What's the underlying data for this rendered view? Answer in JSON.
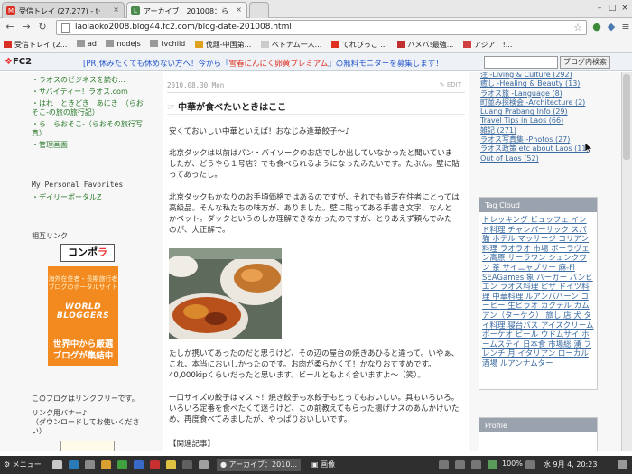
{
  "tabs": [
    {
      "label": "受信トレイ (27,277) - t·",
      "icon": "M",
      "color": "#d93025"
    },
    {
      "label": "アーカイブ：201008：ら",
      "icon": "L",
      "color": "#4a8a4a"
    }
  ],
  "url": "laolaoko2008.blog44.fc2.com/blog-date-201008.html",
  "bookmarks": [
    "受信トレイ (2...",
    "ad",
    "nodejs",
    "tvchild",
    "伐題-中国第...",
    "ベトナム一人...",
    "てれびっこ ...",
    "ハメバ!最強...",
    "アジア！!..."
  ],
  "fc2": {
    "logo": "FC2",
    "msg_a": "[PR]休みたくても休めない方へ！今から『",
    "msg_b": "雪春にんにく卵黄プレミアム",
    "msg_c": "』の無料モニターを募集します！",
    "search_button": "ブログ内検索"
  },
  "left": {
    "links_top": [
      "ラオスのビジネスを読む...",
      "サバイディー！ラオス.com",
      "はれ　ときどき　あにき　（らおそこ-の旅の旅行記）",
      "ら　らおそこ-（らおその旅行写真）",
      "管理画面"
    ],
    "favorites_title": "My Personal Favorites",
    "favorites": [
      "デイリーポータルZ"
    ],
    "mutual_title": "相互リンク",
    "comp_a": "コンポ",
    "comp_b": "ラ",
    "banner_a": "海外在住者・長期旅行者\nブログのポータルサイト",
    "banner_b": "WORLD BLOGGERS",
    "banner_c": "世界中から厳選\nブログが集結中",
    "linkfree": "このブログはリンクフリーです。",
    "banner_title": "リンク用バナー♪\n（ダウンロードしてお使いください）"
  },
  "post": {
    "date": "2010.08.30 Mon",
    "edit": "EDIT",
    "title": "中華が食べたいときはここ",
    "p1": "安くておいしい中華といえば！おなじみ逢華餃子〜♪",
    "p2": "北京ダックは以前はパン・バイソークのお店でしか出していなかったと聞いていましたが、どうやら１号店？でも食べられるようになったみたいです。たぶん。壁に貼ってあったし。",
    "p3": "北京ダックもかなりのお手頃価格ではあるのですが、それでも貧乏在住者にとっては高級品。そんな私たちの味方が、ありました。壁に貼ってある手書き文字、なんとかベット。ダックというのしか理解できなかったのですが、とりあえず頼んでみたのが、大正解で。",
    "p4": "たしか携いてあったのだと思うけど、その辺の屋台の焼きあひると違って。いやぁ、これ、本当においしかったのです。お肉が柔らかくて！かなりおすすめです。40,000kipくらいだったと思います。ビールともよく合いますよ〜（笑）。",
    "p5": "一口サイズの餃子はマスト！焼き餃子も水餃子もとってもおいしい。具もいろいろ。いろいろ定番を食べたくて迷うけど、この前教えてもらった揚げナスのあんかけいため、再度食べてみましたが、やっぱりおいしいです。",
    "related": "【関連記事】"
  },
  "right": {
    "categories": [
      "注 -Living & Culture (292)",
      "癒し -Healing & Beauty (13)",
      "ラオス旅 -Language (8)",
      "町並み探検会 -Architecture (2)",
      "Luang Prabang Info (29)",
      "Travel Tips in Laos (66)",
      "雑記 (271)",
      "ラオス写真集 -Photos (27)",
      "ラオス政策 etc about Laos (11)",
      "Out of Laos (52)"
    ],
    "tagcloud_title": "Tag Cloud",
    "tags": "トレッキング ビュッフェ インド料理 チャンパーサック スパ 猫 ホテル マッサージ コリアン料理 ラオラオ 市場 ボーラヴェン高原 サーラワン シェンクワン 茶 サイニャブリー 麻-Fi SEAGames 象 バーガー バンビエン ラオス料理 ピザ ドイツ料理 中華料理 ルアンパバーン コーヒー 生ビラオ カクテル カムアン（ターケク） 旅し 店 犬 タイ料理 寝台バス アイスクリーム ボーケオ ビール ウドムサイ ホームステイ 日本食 市場総 湧 フレンチ 月 イタリアン ローカル酒場 ルアンナムター",
    "profile_title": "Profile"
  },
  "taskbar": {
    "menu": "メニュー",
    "window": "アーカイブ：2010...",
    "window2": "画像",
    "battery": "100%",
    "clock": "水 9月  4, 20:23"
  }
}
